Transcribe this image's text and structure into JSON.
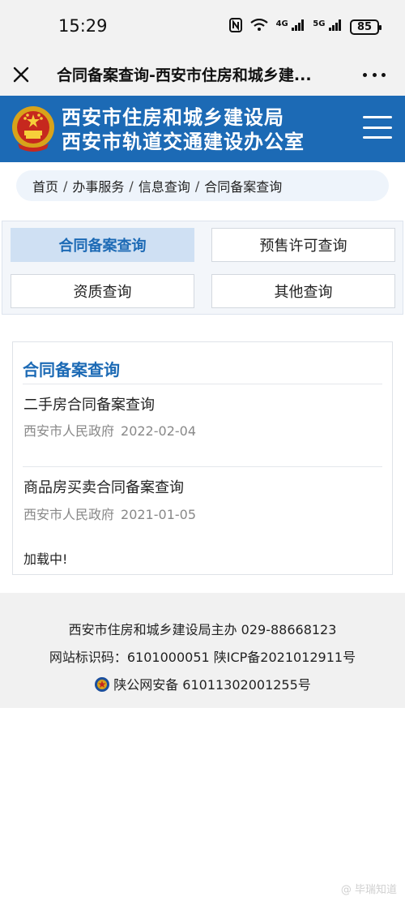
{
  "status_bar": {
    "time": "15:29",
    "nfc_icon": "nfc-icon",
    "signal_4g": "4G",
    "signal_5g": "5G",
    "battery": "85"
  },
  "browser": {
    "title": "合同备案查询-西安市住房和城乡建...",
    "close_icon": "close-icon",
    "more_icon": "more-icon"
  },
  "header": {
    "org_name": "西安市住房和城乡建设局",
    "org_sub": "西安市轨道交通建设办公室",
    "colors": {
      "primary": "#1c6ab5"
    }
  },
  "breadcrumb": {
    "items": [
      "首页",
      "办事服务",
      "信息查询",
      "合同备案查询"
    ],
    "separator": "/"
  },
  "tabs": [
    {
      "label": "合同备案查询",
      "active": true
    },
    {
      "label": "预售许可查询",
      "active": false
    },
    {
      "label": "资质查询",
      "active": false
    },
    {
      "label": "其他查询",
      "active": false
    }
  ],
  "results": {
    "title": "合同备案查询",
    "items": [
      {
        "title": "二手房合同备案查询",
        "source": "西安市人民政府",
        "date": "2022-02-04"
      },
      {
        "title": "商品房买卖合同备案查询",
        "source": "西安市人民政府",
        "date": "2021-01-05"
      }
    ],
    "loading": "加载中!"
  },
  "footer": {
    "line1": "西安市住房和城乡建设局主办 029-88668123",
    "line2": "网站标识码：6101000051 陕ICP备2021012911号",
    "line3": "陕公网安备 61011302001255号"
  },
  "watermark": "@ 毕瑞知道"
}
